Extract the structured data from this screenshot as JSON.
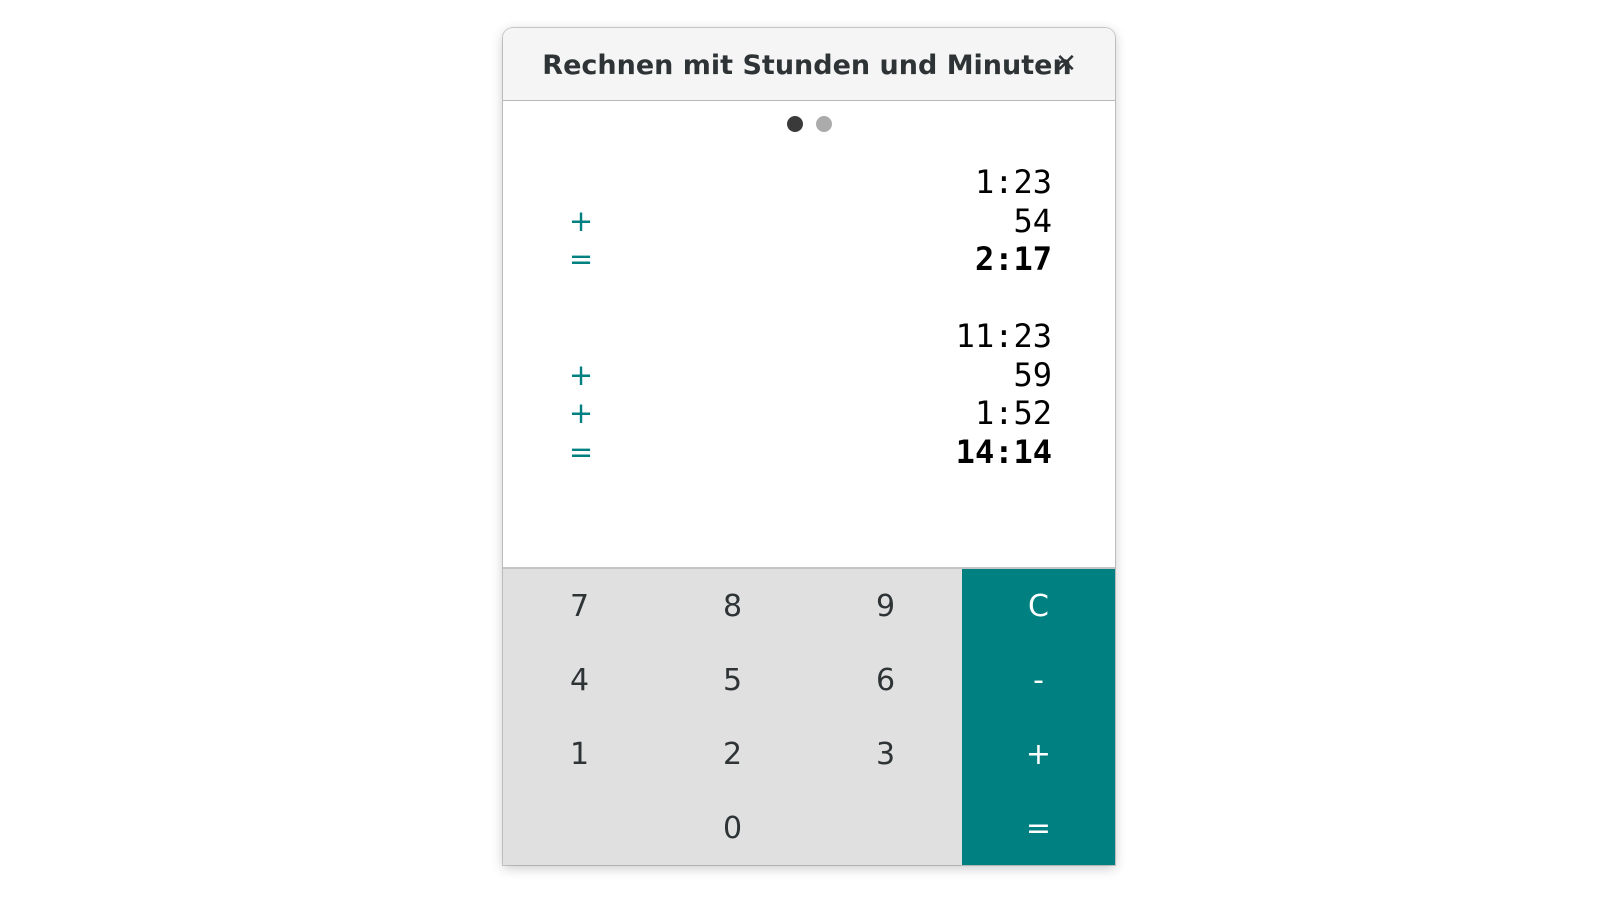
{
  "window": {
    "title": "Rechnen mit Stunden und Minuten",
    "close_symbol": "✕"
  },
  "pager": {
    "page_count": 2,
    "current_page": 1
  },
  "display": {
    "calculation_1": {
      "lines": [
        {
          "op": "",
          "value": "1:23"
        },
        {
          "op": "+",
          "value": "54"
        },
        {
          "op": "=",
          "value": "2:17"
        }
      ]
    },
    "calculation_2": {
      "lines": [
        {
          "op": "",
          "value": "11:23"
        },
        {
          "op": "+",
          "value": "59"
        },
        {
          "op": "+",
          "value": "1:52"
        },
        {
          "op": "=",
          "value": "14:14"
        }
      ]
    }
  },
  "keypad": {
    "k7": "7",
    "k8": "8",
    "k9": "9",
    "clear": "C",
    "k4": "4",
    "k5": "5",
    "k6": "6",
    "minus": "-",
    "k1": "1",
    "k2": "2",
    "k3": "3",
    "plus": "+",
    "k0": "0",
    "equals": "="
  },
  "colors": {
    "accent": "#008080",
    "keypad_bg": "#e0e0e0",
    "dot_active": "#3a3a3a",
    "dot_inactive": "#ababab"
  }
}
